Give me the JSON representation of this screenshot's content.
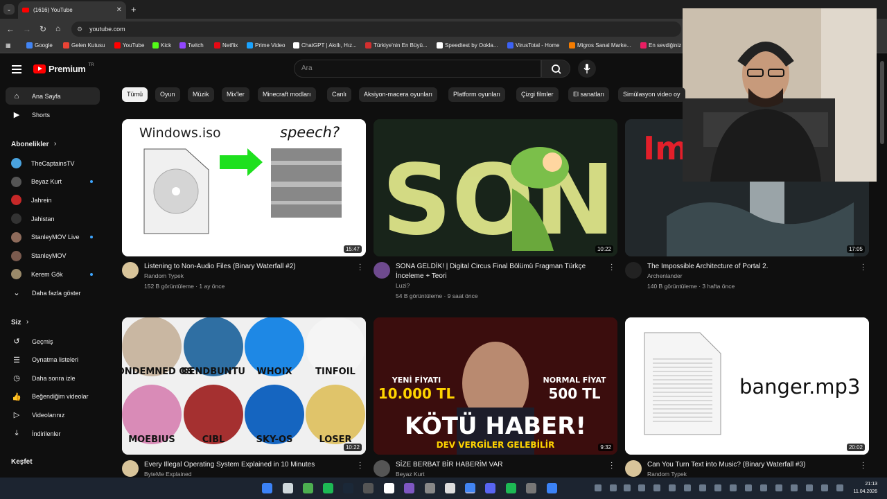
{
  "browser": {
    "tab_title": "(1616) YouTube",
    "url": "youtube.com",
    "bookmarks": [
      "Google",
      "Gelen Kutusu",
      "YouTube",
      "Kick",
      "Twitch",
      "Netflix",
      "Prime Video",
      "ChatGPT | Akıllı, Hız...",
      "Türkiye'nin En Büyü...",
      "Speedtest by Ookla...",
      "VirusTotal - Home",
      "Migros Sanal Marke...",
      "En sevdiğiniz"
    ]
  },
  "header": {
    "logo_text": "Premium",
    "logo_region": "TR",
    "search_placeholder": "Ara"
  },
  "chips": [
    "Tümü",
    "Oyun",
    "Müzik",
    "Mix'ler",
    "Minecraft modları",
    "Canlı",
    "Aksiyon-macera oyunları",
    "Platform oyunları",
    "Çizgi filmler",
    "El sanatları",
    "Simülasyon video oy"
  ],
  "sidebar": {
    "top": [
      {
        "label": "Ana Sayfa",
        "icon": "home-icon"
      },
      {
        "label": "Shorts",
        "icon": "shorts-icon"
      }
    ],
    "subs_title": "Abonelikler",
    "subs": [
      {
        "label": "TheCaptainsTV",
        "dot": false,
        "color": "#4aa3df"
      },
      {
        "label": "Beyaz Kurt",
        "dot": true,
        "color": "#555555"
      },
      {
        "label": "Jahrein",
        "dot": false,
        "color": "#c62828"
      },
      {
        "label": "Jahistan",
        "dot": false,
        "color": "#333333"
      },
      {
        "label": "StanleyMOV Live",
        "dot": true,
        "color": "#8e6b5b"
      },
      {
        "label": "StanleyMOV",
        "dot": false,
        "color": "#7a5a4e"
      },
      {
        "label": "Kerem Gök",
        "dot": true,
        "color": "#9a8a6a"
      }
    ],
    "more": "Daha fazla göster",
    "you_title": "Siz",
    "you": [
      {
        "label": "Geçmiş",
        "icon": "history-icon"
      },
      {
        "label": "Oynatma listeleri",
        "icon": "playlist-icon"
      },
      {
        "label": "Daha sonra izle",
        "icon": "watch-later-icon"
      },
      {
        "label": "Beğendiğim videolar",
        "icon": "like-icon"
      },
      {
        "label": "Videolarınız",
        "icon": "your-videos-icon"
      },
      {
        "label": "İndirilenler",
        "icon": "download-icon"
      }
    ],
    "explore_title": "Keşfet"
  },
  "videos": [
    {
      "title": "Listening to Non-Audio Files (Binary Waterfall #2)",
      "channel": "Random Typek",
      "verified": true,
      "meta": "152 B görüntüleme · 1 ay önce",
      "duration": "15:47",
      "thumb_text": [
        "Windows.iso",
        "speech?"
      ]
    },
    {
      "title": "SONA GELDİK! | Digital Circus Final Bölümü Fragman Türkçe İnceleme + Teori",
      "channel": "Luzi?",
      "verified": false,
      "meta": "54 B görüntüleme · 9 saat önce",
      "duration": "10:22",
      "thumb_text": [
        "SON?"
      ]
    },
    {
      "title": "The Impossible Architecture of Portal 2.",
      "channel": "Archenlander",
      "verified": false,
      "meta": "140 B görüntüleme · 3 hafta önce",
      "duration": "17:05",
      "thumb_text": [
        "Im"
      ]
    },
    {
      "title": "Every Illegal Operating System Explained in 10 Minutes",
      "channel": "ByteMe Explained",
      "verified": false,
      "meta": "",
      "duration": "10:22",
      "thumb_text": [
        "CONDEMNED OS",
        "GENDBUNTU",
        "WHOIX",
        "TINFOIL",
        "MOEBIUS",
        "CIBL",
        "SKY-OS",
        "LOSER"
      ]
    },
    {
      "title": "SİZE BERBAT BİR HABERİM VAR",
      "channel": "Beyaz Kurt",
      "verified": true,
      "meta": "",
      "duration": "9:32",
      "thumb_text": [
        "YENİ FİYATI",
        "10.000 TL",
        "NORMAL FİYAT",
        "500 TL",
        "KÖTÜ HABER!",
        "DEV VERGİLER GELEBİLİR"
      ]
    },
    {
      "title": "Can You Turn Text into Music? (Binary Waterfall #3)",
      "channel": "Random Typek",
      "verified": true,
      "meta": "",
      "duration": "20:02",
      "thumb_text": [
        "banger.mp3"
      ]
    }
  ],
  "clock": {
    "time": "21:13",
    "date": "11.04.2026"
  }
}
